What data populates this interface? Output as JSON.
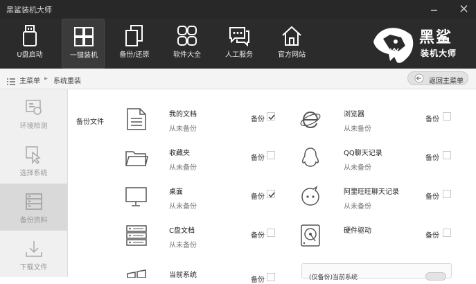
{
  "window": {
    "title": "黑鲨装机大师"
  },
  "nav": {
    "items": [
      {
        "label": "U盘启动",
        "icon": "usb-drive-icon"
      },
      {
        "label": "一键装机",
        "icon": "windows-logo-icon"
      },
      {
        "label": "备份/还原",
        "icon": "copy-restore-icon"
      },
      {
        "label": "软件大全",
        "icon": "apps-grid-icon"
      },
      {
        "label": "人工服务",
        "icon": "chat-bubbles-icon"
      },
      {
        "label": "官方网站",
        "icon": "home-icon"
      }
    ],
    "active": "一键装机"
  },
  "logo": {
    "line1": "黑鲨",
    "line2": "装机大师"
  },
  "breadcrumb": {
    "menu": "主菜单",
    "current": "系统重装",
    "back": "返回主菜单"
  },
  "sidebar": {
    "items": [
      {
        "label": "环境检测"
      },
      {
        "label": "选择系统"
      },
      {
        "label": "备份资料"
      },
      {
        "label": "下载文件"
      }
    ],
    "active": "备份资料"
  },
  "backup": {
    "section_label": "备份文件",
    "backup_label": "备份",
    "items": [
      {
        "name": "我的文档",
        "status": "从未备份",
        "checked": true,
        "icon": "document-icon"
      },
      {
        "name": "浏览器",
        "status": "从未备份",
        "checked": false,
        "icon": "ie-browser-icon"
      },
      {
        "name": "收藏夹",
        "status": "从未备份",
        "checked": false,
        "icon": "folder-icon"
      },
      {
        "name": "QQ聊天记录",
        "status": "从未备份",
        "checked": false,
        "icon": "qq-penguin-icon"
      },
      {
        "name": "桌面",
        "status": "从未备份",
        "checked": true,
        "icon": "monitor-icon"
      },
      {
        "name": "阿里旺旺聊天记录",
        "status": "从未备份",
        "checked": false,
        "icon": "aliwangwang-icon"
      },
      {
        "name": "C盘文档",
        "status": "从未备份",
        "checked": false,
        "icon": "server-drive-icon"
      },
      {
        "name": "硬件驱动",
        "status": "",
        "checked": false,
        "icon": "hard-disk-icon"
      },
      {
        "name": "当前系统",
        "status": "",
        "checked": false,
        "icon": "windows-logo-icon"
      }
    ],
    "panel_text": "(仅备份)当前系统"
  }
}
